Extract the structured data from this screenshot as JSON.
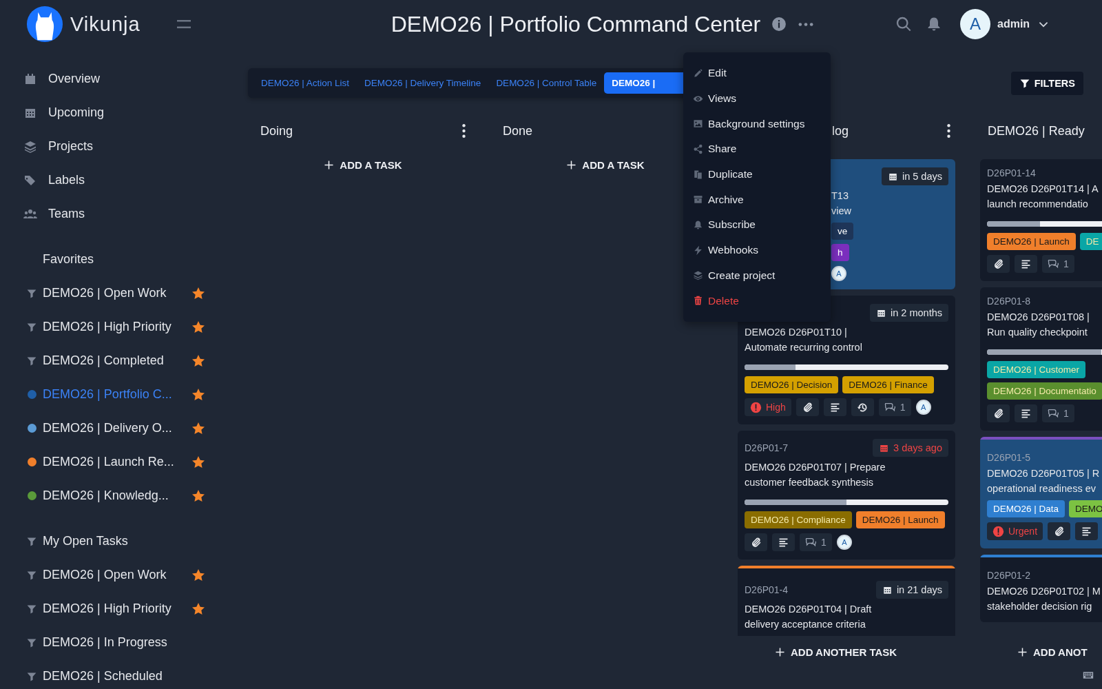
{
  "header": {
    "app_name": "Vikunja",
    "title": "DEMO26 | Portfolio Command Center",
    "user": {
      "initial": "A",
      "name": "admin"
    }
  },
  "sidebar": {
    "nav": [
      {
        "label": "Overview"
      },
      {
        "label": "Upcoming"
      },
      {
        "label": "Projects"
      },
      {
        "label": "Labels"
      },
      {
        "label": "Teams"
      }
    ],
    "sections": [
      {
        "title": "Favorites",
        "kind": "plain",
        "items": [
          {
            "label": "DEMO26 | Open Work",
            "kind": "filter",
            "favorite": true,
            "selected": false
          },
          {
            "label": "DEMO26 | High Priority",
            "kind": "filter",
            "favorite": true,
            "selected": false
          },
          {
            "label": "DEMO26 | Completed",
            "kind": "filter",
            "favorite": true,
            "selected": false
          },
          {
            "label": "DEMO26 | Portfolio C...",
            "kind": "project",
            "color": "#1f5fa8",
            "favorite": true,
            "selected": true
          },
          {
            "label": "DEMO26 | Delivery O...",
            "kind": "project",
            "color": "#5b9bd5",
            "favorite": true,
            "selected": false
          },
          {
            "label": "DEMO26 | Launch Re...",
            "kind": "project",
            "color": "#f07f2b",
            "favorite": true,
            "selected": false
          },
          {
            "label": "DEMO26 | Knowledg...",
            "kind": "project",
            "color": "#5a9a3a",
            "favorite": true,
            "selected": false
          }
        ]
      },
      {
        "title": "My Open Tasks",
        "kind": "filter",
        "items": [
          {
            "label": "DEMO26 | Open Work",
            "kind": "filter",
            "favorite": true,
            "selected": false
          },
          {
            "label": "DEMO26 | High Priority",
            "kind": "filter",
            "favorite": true,
            "selected": false
          },
          {
            "label": "DEMO26 | In Progress",
            "kind": "filter",
            "favorite": false,
            "selected": false
          },
          {
            "label": "DEMO26 | Scheduled",
            "kind": "filter",
            "favorite": false,
            "selected": false
          }
        ]
      }
    ]
  },
  "views": [
    {
      "label": "DEMO26 | Action List",
      "selected": false
    },
    {
      "label": "DEMO26 | Delivery Timeline",
      "selected": false
    },
    {
      "label": "DEMO26 | Control Table",
      "selected": false
    },
    {
      "label": "DEMO26 |",
      "selected": true
    }
  ],
  "filters_button": "FILTERS",
  "project_menu": [
    {
      "label": "Edit",
      "kind": "normal"
    },
    {
      "label": "Views",
      "kind": "normal"
    },
    {
      "label": "Background settings",
      "kind": "normal"
    },
    {
      "label": "Share",
      "kind": "normal"
    },
    {
      "label": "Duplicate",
      "kind": "normal"
    },
    {
      "label": "Archive",
      "kind": "normal"
    },
    {
      "label": "Subscribe",
      "kind": "normal"
    },
    {
      "label": "Webhooks",
      "kind": "normal"
    },
    {
      "label": "Create project",
      "kind": "normal"
    },
    {
      "label": "Delete",
      "kind": "danger"
    }
  ],
  "columns": [
    {
      "title": "Doing",
      "menu": true,
      "add_label": "ADD A TASK"
    },
    {
      "title": "Done",
      "menu": false,
      "add_label": "ADD A TASK"
    },
    {
      "title": "log",
      "covered": true,
      "menu": true,
      "add_label": "ADD ANOTHER TASK",
      "cards": [
        {
          "covered": true,
          "color": "#1f4e7d",
          "due": {
            "text": "in 5 days",
            "overdue": false
          },
          "title": "T13\nview",
          "labels": [
            {
              "text": "ve",
              "color": "#1e3558"
            },
            {
              "text": "h",
              "color": "#7b2fbe"
            }
          ],
          "assignee": "A"
        },
        {
          "covered": false,
          "due": {
            "text": "in 2 months",
            "overdue": false
          },
          "title": "DEMO26 D26P01T10 |\nAutomate recurring control",
          "level": 0.25,
          "labels": [
            {
              "text": "DEMO26 | Decision",
              "color": "#d4a000"
            },
            {
              "text": "DEMO26 | Finance",
              "color": "#d4a000"
            }
          ],
          "badges": [
            {
              "kind": "priority",
              "text": "High"
            },
            {
              "kind": "attachment"
            },
            {
              "kind": "description"
            },
            {
              "kind": "repeat"
            },
            {
              "kind": "comments",
              "text": "1"
            }
          ],
          "assignee": "A"
        },
        {
          "covered": false,
          "id": "D26P01-7",
          "due": {
            "text": "3 days ago",
            "overdue": true
          },
          "title": "DEMO26 D26P01T07 | Prepare\ncustomer feedback synthesis",
          "level": 0.5,
          "labels": [
            {
              "text": "DEMO26 | Compliance",
              "color": "#8a6d00"
            },
            {
              "text": "DEMO26 | Launch",
              "color": "#f07f2b"
            }
          ],
          "badges": [
            {
              "kind": "attachment"
            },
            {
              "kind": "description"
            },
            {
              "kind": "comments",
              "text": "1"
            }
          ],
          "assignee": "A"
        },
        {
          "covered": false,
          "top_bar": {
            "color": "#f07f2b"
          },
          "id": "D26P01-4",
          "due": {
            "text": "in 21 days",
            "overdue": false
          },
          "title": "DEMO26 D26P01T04 | Draft\ndelivery acceptance criteria"
        }
      ]
    },
    {
      "title": "DEMO26 | Ready",
      "menu": false,
      "add_label": "ADD ANOT",
      "cards": [
        {
          "covered": false,
          "id": "D26P01-14",
          "title": "DEMO26 D26P01T14 | A\nlaunch recommendatio",
          "level": 0.26,
          "labels": [
            {
              "text": "DEMO26 | Launch",
              "color": "#f07f2b"
            },
            {
              "text": "DE",
              "color": "#0aa6a6"
            }
          ],
          "badges": [
            {
              "kind": "attachment"
            },
            {
              "kind": "description"
            },
            {
              "kind": "comments",
              "text": "1"
            }
          ]
        },
        {
          "covered": false,
          "id": "D26P01-8",
          "title": "DEMO26 D26P01T08 |\nRun quality checkpoint",
          "level": 0.56,
          "labels": [
            {
              "text": "DEMO26 | Customer",
              "color": "#0aa6a6"
            },
            {
              "text": "DEMO26 | Documentatio",
              "color": "#5a8f2e"
            }
          ],
          "badges": [
            {
              "kind": "attachment"
            },
            {
              "kind": "description"
            },
            {
              "kind": "comments",
              "text": "1"
            }
          ]
        },
        {
          "covered": false,
          "color": "#1f4e7d",
          "top_bar": {
            "color": "#7b4fbe"
          },
          "id": "D26P01-5",
          "title": "DEMO26 D26P01T05 | R\noperational readiness ev",
          "labels": [
            {
              "text": "DEMO26 | Data",
              "color": "#2f7fd0"
            },
            {
              "text": "DEMO",
              "color": "#7cc242"
            }
          ],
          "badges": [
            {
              "kind": "priority",
              "text": "Urgent"
            },
            {
              "kind": "attachment"
            },
            {
              "kind": "description"
            }
          ]
        },
        {
          "covered": false,
          "top_bar": {
            "color": "#2f7fd0"
          },
          "id": "D26P01-2",
          "title": "DEMO26 D26P01T02 | M\nstakeholder decision rig"
        }
      ]
    }
  ]
}
